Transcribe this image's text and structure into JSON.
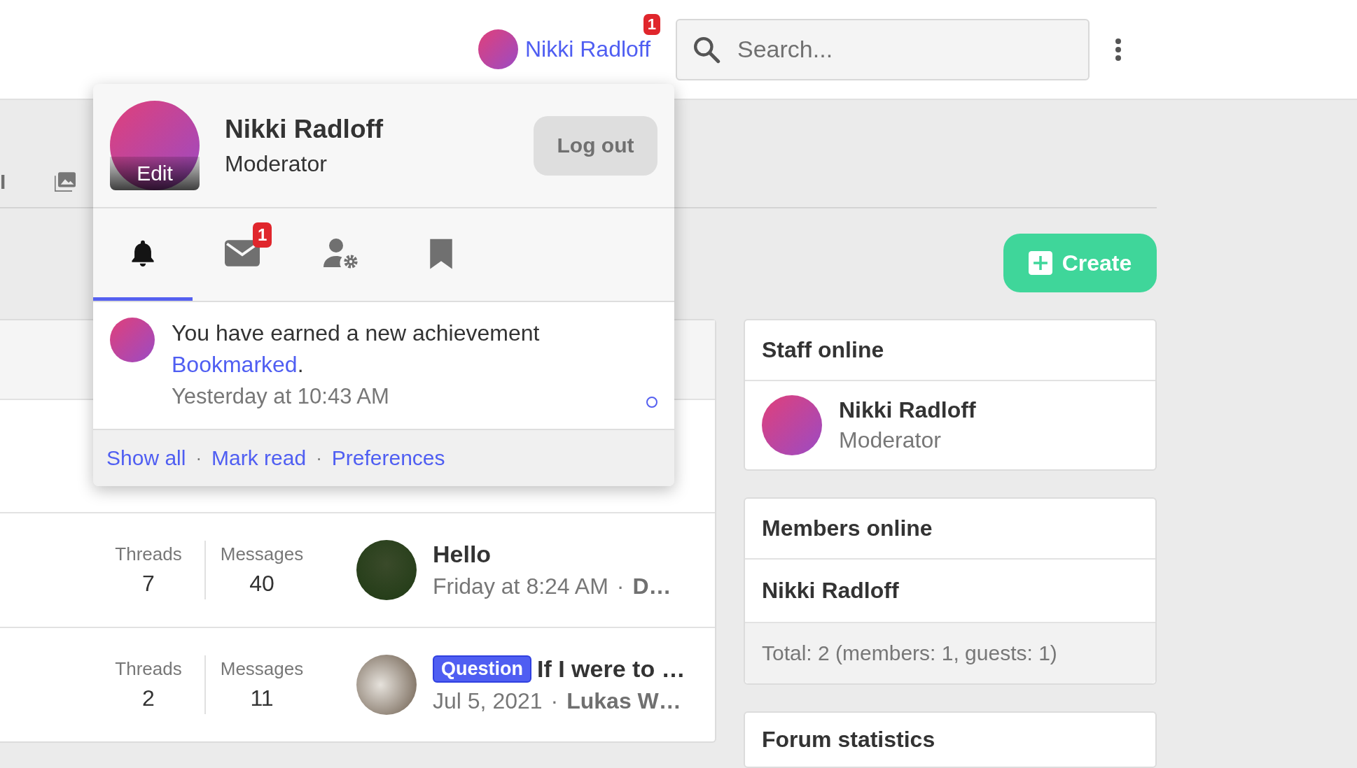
{
  "header": {
    "user": {
      "name": "Nikki Radloff",
      "badge": "1"
    },
    "search": {
      "placeholder": "Search..."
    }
  },
  "nav": {
    "items": [
      {
        "label": "I"
      }
    ]
  },
  "create_button": {
    "label": "Create"
  },
  "forum_rows": [
    {
      "threads_label": "Threads",
      "threads": "7",
      "messages_label": "Messages",
      "messages": "40",
      "title": "Hello",
      "date": "Friday at 8:24 AM",
      "separator": "·",
      "author": "D…"
    },
    {
      "threads_label": "Threads",
      "threads": "2",
      "messages_label": "Messages",
      "messages": "11",
      "prefix": "Question",
      "title": "If I were to …",
      "date": "Jul 5, 2021",
      "separator": "·",
      "author": "Lukas W…"
    }
  ],
  "sidebar": [
    {
      "kind": "staff",
      "title": "Staff online",
      "members": [
        {
          "name": "Nikki Radloff",
          "role": "Moderator"
        }
      ]
    },
    {
      "kind": "members",
      "title": "Members online",
      "names": [
        "Nikki Radloff"
      ],
      "footer": "Total: 2 (members: 1, guests: 1)"
    },
    {
      "kind": "stats",
      "title": "Forum statistics"
    }
  ],
  "popup": {
    "name": "Nikki Radloff",
    "role": "Moderator",
    "avatar_label": "Edit",
    "logout": "Log out",
    "tabs": [
      {
        "selected": true
      },
      {
        "selected": false,
        "badge": "1"
      },
      {
        "selected": false
      },
      {
        "selected": false
      }
    ],
    "notifications": [
      {
        "text": "You have earned a new achievement",
        "link": "Bookmarked",
        "suffix": ".",
        "time": "Yesterday at 10:43 AM",
        "unread": true
      }
    ],
    "footer_links": [
      "Show all",
      "Mark read",
      "Preferences"
    ],
    "footer_separator": "·"
  }
}
